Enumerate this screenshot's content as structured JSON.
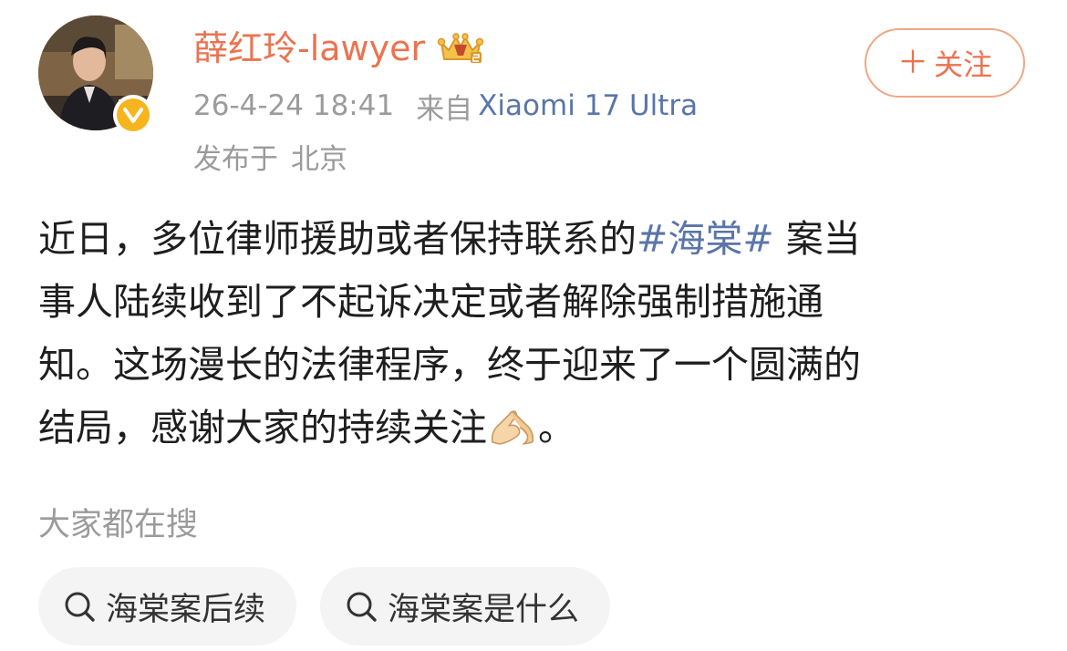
{
  "profile": {
    "username": "薛红玲-lawyer",
    "post_time": "26-4-24 18:41",
    "from_label": "来自",
    "device": "Xiaomi 17 Ultra",
    "location_label": "发布于",
    "location": "北京",
    "verified_color": "#f6b51e",
    "crown_icon": "crown-badge-icon"
  },
  "follow": {
    "label": "关注",
    "plus_icon": "＋"
  },
  "post": {
    "line1_a": "近日，多位律师援助或者保持联系的",
    "hashtag": "#海棠#",
    "line1_b": " 案当",
    "line2": "事人陆续收到了不起诉决定或者解除强制措施通",
    "line3": "知。这场漫长的法律程序，终于迎来了一个圆满的",
    "line4_a": "结局，感谢大家的持续关注",
    "line4_emoji": "folded-hands-emoji-icon",
    "line4_b": "。"
  },
  "search": {
    "heading": "大家都在搜",
    "chips": [
      {
        "label": "海棠案后续"
      },
      {
        "label": "海棠案是什么"
      }
    ]
  },
  "colors": {
    "accent": "#eb7350",
    "link": "#5a75a8",
    "muted": "#9b9b9b",
    "chip_bg": "#f4f4f4"
  }
}
